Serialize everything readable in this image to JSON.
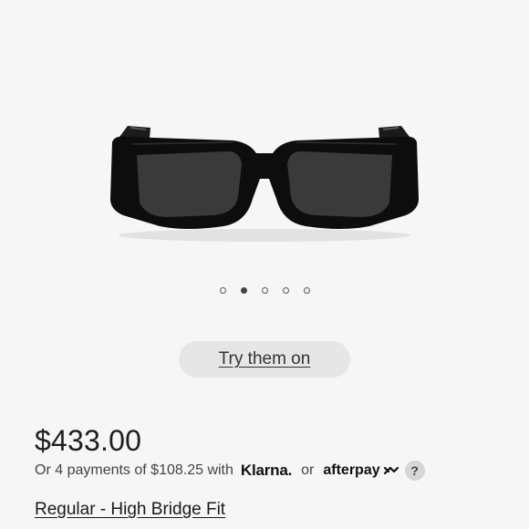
{
  "product": {
    "image_icon": "sunglasses-black-rectangular",
    "carousel": {
      "count": 5,
      "active_index": 1
    },
    "try_on_label": "Try them on",
    "price": "$433.00",
    "installments": {
      "text": "Or 4 payments of $108.25 with",
      "klarna": "Klarna.",
      "or": "or",
      "afterpay": "afterpay",
      "help": "?"
    },
    "fit_label": "Regular - High Bridge Fit"
  }
}
